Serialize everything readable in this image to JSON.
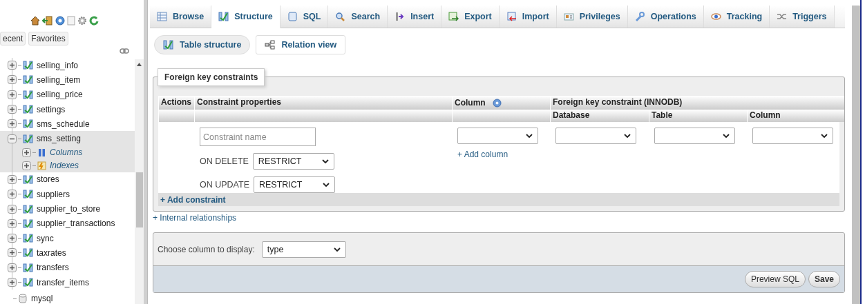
{
  "sidebar": {
    "tabs": [
      {
        "label": "ecent"
      },
      {
        "label": "Favorites"
      }
    ],
    "tables": [
      {
        "name": "selling_info",
        "expanded": false
      },
      {
        "name": "selling_item",
        "expanded": false
      },
      {
        "name": "selling_price",
        "expanded": false
      },
      {
        "name": "settings",
        "expanded": false
      },
      {
        "name": "sms_schedule",
        "expanded": false
      },
      {
        "name": "sms_setting",
        "expanded": true,
        "children": [
          {
            "name": "Columns",
            "kind": "columns"
          },
          {
            "name": "Indexes",
            "kind": "indexes"
          }
        ]
      },
      {
        "name": "stores",
        "expanded": false
      },
      {
        "name": "suppliers",
        "expanded": false
      },
      {
        "name": "supplier_to_store",
        "expanded": false
      },
      {
        "name": "supplier_transactions",
        "expanded": false
      },
      {
        "name": "sync",
        "expanded": false
      },
      {
        "name": "taxrates",
        "expanded": false
      },
      {
        "name": "transfers",
        "expanded": false
      },
      {
        "name": "transfer_items",
        "expanded": false
      }
    ],
    "database": {
      "name": "mysql"
    }
  },
  "tabs": [
    {
      "label": "Browse",
      "selected": false
    },
    {
      "label": "Structure",
      "selected": true
    },
    {
      "label": "SQL",
      "selected": false
    },
    {
      "label": "Search",
      "selected": false
    },
    {
      "label": "Insert",
      "selected": false
    },
    {
      "label": "Export",
      "selected": false
    },
    {
      "label": "Import",
      "selected": false
    },
    {
      "label": "Privileges",
      "selected": false
    },
    {
      "label": "Operations",
      "selected": false
    },
    {
      "label": "Tracking",
      "selected": false
    },
    {
      "label": "Triggers",
      "selected": false
    }
  ],
  "subtabs": [
    {
      "label": "Table structure",
      "selected": true
    },
    {
      "label": "Relation view",
      "selected": false
    }
  ],
  "foreign_keys": {
    "legend": "Foreign key constraints",
    "headers": {
      "actions": "Actions",
      "properties": "Constraint properties",
      "column": "Column",
      "target": "Foreign key constraint (INNODB)",
      "database": "Database",
      "table": "Table",
      "target_column": "Column"
    },
    "row": {
      "placeholder": "Constraint name",
      "on_delete": {
        "label": "ON DELETE",
        "value": "RESTRICT"
      },
      "on_update": {
        "label": "ON UPDATE",
        "value": "RESTRICT"
      },
      "add_column": "+ Add column"
    },
    "add_constraint": "+ Add constraint"
  },
  "internal_link": "+ Internal relationships",
  "display": {
    "label": "Choose column to display:",
    "value": "type"
  },
  "buttons": [
    "Preview SQL",
    "Save"
  ]
}
